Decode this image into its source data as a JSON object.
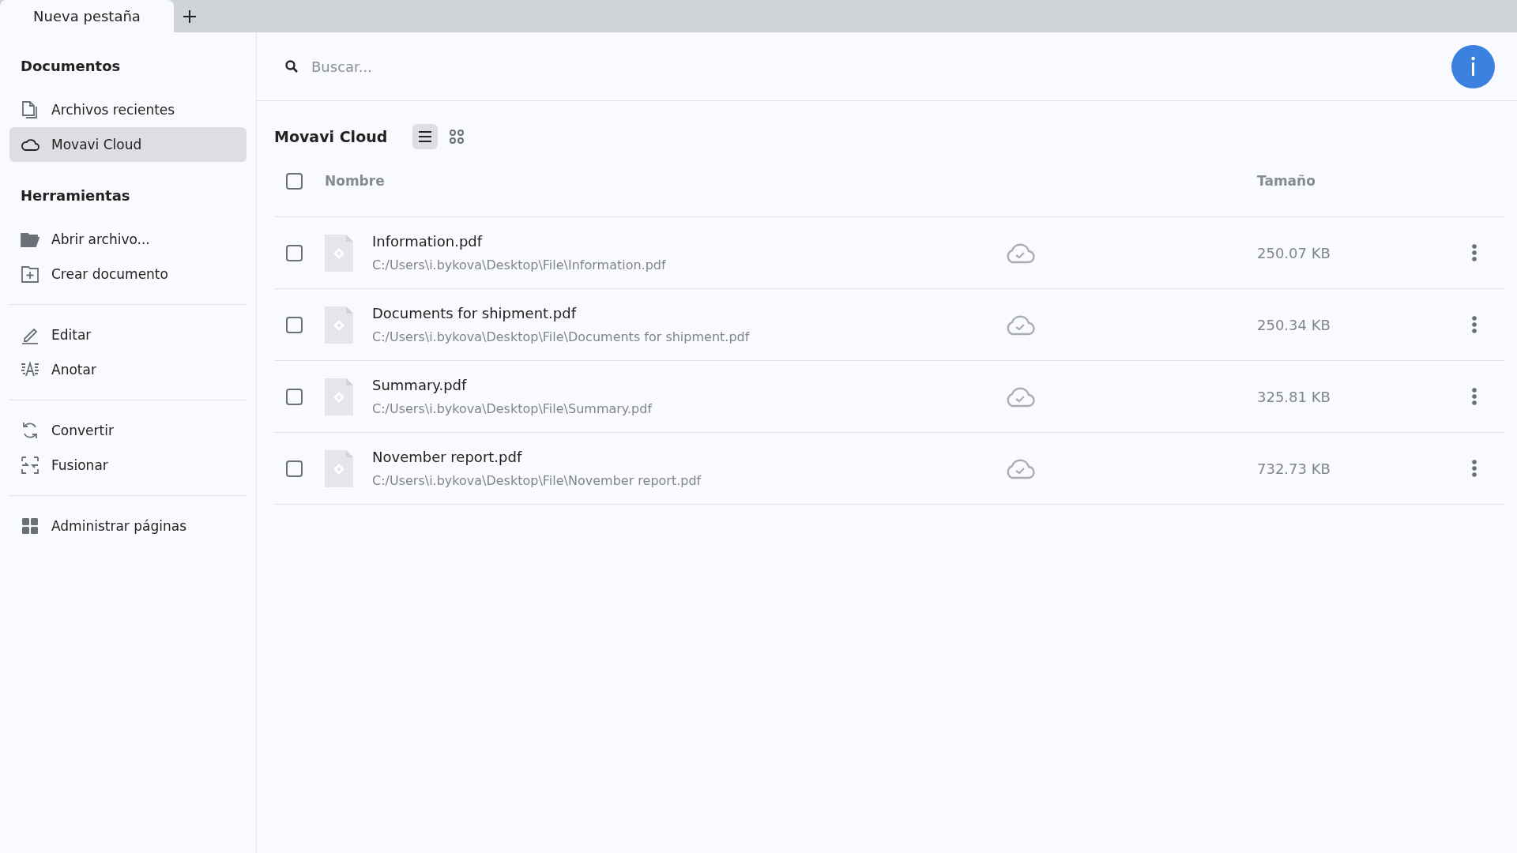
{
  "tabs": [
    {
      "label": "Nueva pestaña",
      "selected": true
    }
  ],
  "sidebar": {
    "groups": [
      {
        "heading": "Documentos",
        "items": [
          {
            "kind": "recent",
            "label": "Archivos recientes",
            "selected": false
          },
          {
            "kind": "cloud",
            "label": "Movavi Cloud",
            "selected": true
          }
        ]
      },
      {
        "heading": "Herramientas",
        "items": [
          {
            "kind": "open",
            "label": "Abrir archivo...",
            "selected": false
          },
          {
            "kind": "create",
            "label": "Crear documento",
            "selected": false
          }
        ]
      },
      {
        "items": [
          {
            "kind": "edit",
            "label": "Editar",
            "selected": false
          },
          {
            "kind": "annotate",
            "label": "Anotar",
            "selected": false
          }
        ]
      },
      {
        "items": [
          {
            "kind": "convert",
            "label": "Convertir",
            "selected": false
          },
          {
            "kind": "merge",
            "label": "Fusionar",
            "selected": false
          }
        ]
      },
      {
        "items": [
          {
            "kind": "pages",
            "label": "Administrar páginas",
            "selected": false
          }
        ]
      }
    ]
  },
  "search": {
    "placeholder": "Buscar..."
  },
  "content": {
    "title": "Movavi Cloud",
    "views": [
      {
        "kind": "list",
        "selected": true
      },
      {
        "kind": "grid",
        "selected": false
      }
    ]
  },
  "table": {
    "select_all": {
      "checked": false
    },
    "columns": [
      "Nombre",
      "Tamaño"
    ],
    "rows": [
      {
        "checked": false,
        "name": "Information.pdf",
        "path": "C:/Users\\i.bykova\\Desktop\\File\\Information.pdf",
        "size": "250.07 KB"
      },
      {
        "checked": false,
        "name": "Documents for shipment.pdf",
        "path": "C:/Users\\i.bykova\\Desktop\\File\\Documents for shipment.pdf",
        "size": "250.34 KB"
      },
      {
        "checked": false,
        "name": "Summary.pdf",
        "path": "C:/Users\\i.bykova\\Desktop\\File\\Summary.pdf",
        "size": "325.81 KB"
      },
      {
        "checked": false,
        "name": "November report.pdf",
        "path": "C:/Users\\i.bykova\\Desktop\\File\\November report.pdf",
        "size": "732.73 KB"
      }
    ]
  }
}
